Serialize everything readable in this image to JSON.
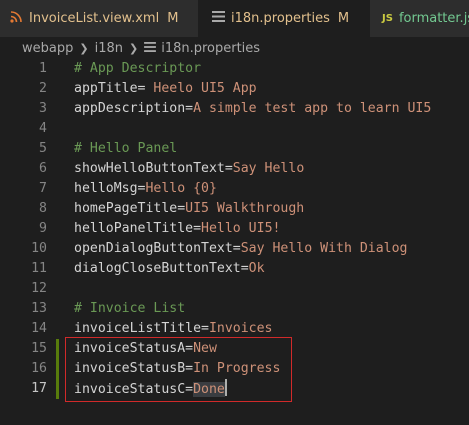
{
  "tabs": [
    {
      "label": "InvoiceList.view.xml",
      "status": "M",
      "icon": "rss-icon"
    },
    {
      "label": "i18n.properties",
      "status": "M",
      "icon": "list-icon"
    },
    {
      "label": "formatter.js",
      "status": "",
      "icon": "js-icon",
      "icon_text": "JS"
    }
  ],
  "breadcrumb": [
    "webapp",
    "i18n",
    "i18n.properties"
  ],
  "lines": [
    {
      "n": "1",
      "comment": "# App Descriptor"
    },
    {
      "n": "2",
      "key": "appTitle= ",
      "value": "Heelo UI5 App"
    },
    {
      "n": "3",
      "key": "appDescription=",
      "value": "A simple test app to learn UI5"
    },
    {
      "n": "4"
    },
    {
      "n": "5",
      "comment": "# Hello Panel"
    },
    {
      "n": "6",
      "key": "showHelloButtonText=",
      "value": "Say Hello"
    },
    {
      "n": "7",
      "key": "helloMsg=",
      "value": "Hello {0}"
    },
    {
      "n": "8",
      "key": "homePageTitle=",
      "value": "UI5 Walkthrough"
    },
    {
      "n": "9",
      "key": "helloPanelTitle=",
      "value": "Hello UI5!"
    },
    {
      "n": "10",
      "key": "openDialogButtonText=",
      "value": "Say Hello With Dialog"
    },
    {
      "n": "11",
      "key": "dialogCloseButtonText=",
      "value": "Ok"
    },
    {
      "n": "12"
    },
    {
      "n": "13",
      "comment": "# Invoice List"
    },
    {
      "n": "14",
      "key": "invoiceListTitle=",
      "value": "Invoices"
    },
    {
      "n": "15",
      "key": "invoiceStatusA=",
      "value": "New"
    },
    {
      "n": "16",
      "key": "invoiceStatusB=",
      "value": "In Progress"
    },
    {
      "n": "17",
      "key": "invoiceStatusC=",
      "value": "Done"
    }
  ],
  "colors": {
    "comment": "#6a9955",
    "value": "#ce9178",
    "modified": "#e2c08d",
    "added_gutter": "#587c0c",
    "highlight_border": "#d12a2a"
  }
}
